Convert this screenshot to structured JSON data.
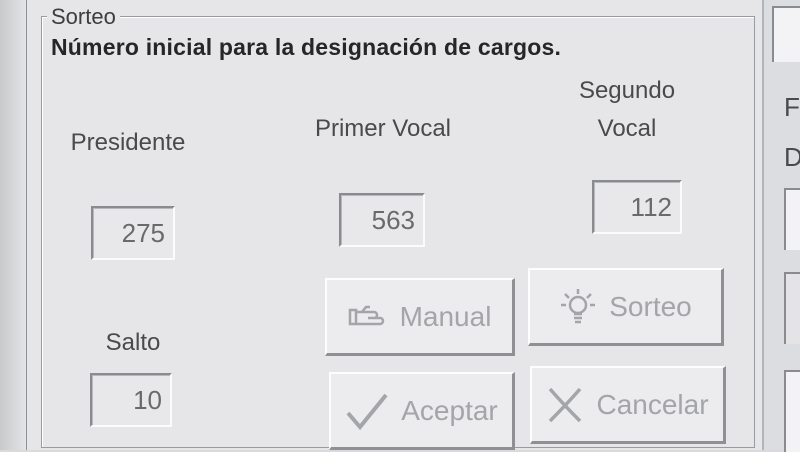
{
  "groupbox": {
    "title": "Sorteo"
  },
  "heading": "Número inicial para la designación de cargos.",
  "labels": {
    "presidente": "Presidente",
    "primer_vocal": "Primer Vocal",
    "segundo_vocal_line1": "Segundo",
    "segundo_vocal_line2": "Vocal",
    "salto": "Salto"
  },
  "fields": {
    "presidente": "275",
    "primer_vocal": "563",
    "segundo_vocal": "112",
    "salto": "10"
  },
  "buttons": {
    "manual": {
      "label": "Manual",
      "icon": "pointing-hand-icon",
      "enabled": false
    },
    "sorteo": {
      "label": "Sorteo",
      "icon": "lightbulb-icon",
      "enabled": false
    },
    "aceptar": {
      "label": "Aceptar",
      "icon": "checkmark-icon",
      "enabled": false
    },
    "cancelar": {
      "label": "Cancelar",
      "icon": "x-mark-icon",
      "enabled": false
    }
  },
  "right_panel": {
    "letters": [
      "F",
      "D"
    ]
  },
  "colors": {
    "window_bg": "#e6e6e8",
    "disabled_text": "#a4a5a8",
    "label_text": "#4a4a4d"
  }
}
